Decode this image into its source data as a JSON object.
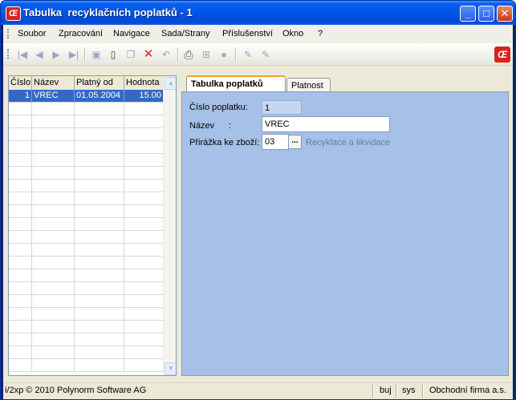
{
  "window": {
    "title": "Tabulka  recyklačních poplatků - 1",
    "logo_text": "Œ",
    "controls": {
      "minimize": "_",
      "maximize": "□",
      "close": "✕"
    }
  },
  "menu": [
    "Soubor",
    "Zpracování",
    "Navigace",
    "Sada/Strany",
    "Příslušenství",
    "Okno",
    "?"
  ],
  "toolbar": {
    "icons": [
      "first-record-icon",
      "previous-record-icon",
      "next-record-icon",
      "last-record-icon",
      "save-icon",
      "new-document-icon",
      "copy-icon",
      "delete-icon",
      "undo-icon",
      "print-icon",
      "tree-icon",
      "circle-icon",
      "edit-pencil-icon",
      "edit-pencil-alt-icon"
    ],
    "glyphs": {
      "first": "|◀",
      "prev": "◀",
      "next": "▶",
      "last": "▶|",
      "save": "▣",
      "new": "▯",
      "copy": "❐",
      "delete": "✕",
      "undo": "↶",
      "print": "⎙",
      "tree": "⊞",
      "circle": "●",
      "edit": "✎",
      "edit2": "✎"
    },
    "delete_color": "#e02020",
    "print_color": "#555555"
  },
  "grid": {
    "columns": [
      "Číslo",
      "Název",
      "Platný od",
      "Hodnota"
    ],
    "rows": [
      {
        "cislo": "1",
        "nazev": "VREC",
        "platny_od": "01.05.2004",
        "hodnota": "15.00"
      }
    ],
    "empty_rows": 21,
    "scroll_up": "▲",
    "scroll_down": "▼"
  },
  "tabs": [
    "Tabulka poplatků",
    "Platnost"
  ],
  "form": {
    "cislo_label": "Číslo poplatku:",
    "cislo_value": "1",
    "nazev_label": "Název",
    "nazev_colon": ":",
    "nazev_value": "VREC",
    "prirazka_label": "Přirážka ke zboží:",
    "prirazka_value": "03",
    "prirazka_button": "...",
    "prirazka_desc": "Recyklace a likvidace"
  },
  "statusbar": {
    "copyright": "i/2xp © 2010 Polynorm Software AG",
    "user": "buj",
    "schema": "sys",
    "company": "Obchodní firma a.s."
  }
}
